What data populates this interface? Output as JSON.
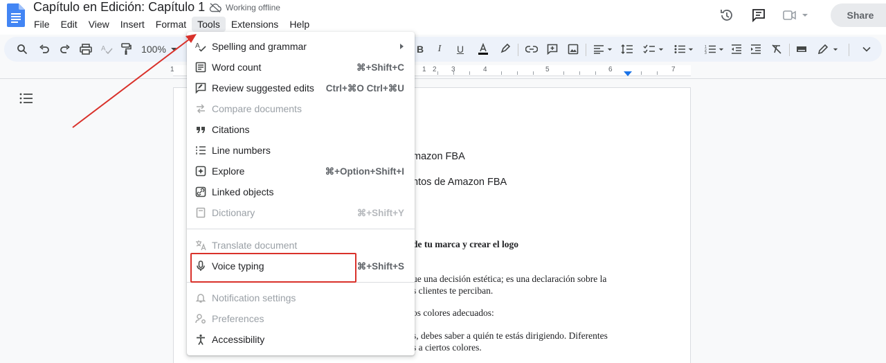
{
  "header": {
    "title": "Capítulo en Edición: Capítulo 1",
    "offline_status": "Working offline",
    "share_label": "Share"
  },
  "menubar": {
    "items": [
      "File",
      "Edit",
      "View",
      "Insert",
      "Format",
      "Tools",
      "Extensions",
      "Help"
    ],
    "active": "Tools"
  },
  "toolbar": {
    "zoom": "100%"
  },
  "ruler": {
    "labels": [
      "1",
      "1",
      "2",
      "3",
      "4",
      "5",
      "6",
      "7"
    ]
  },
  "document": {
    "lines": [
      "mazon FBA",
      "ntos de Amazon FBA",
      "de tu marca y crear el logo",
      "ue una decisión estética; es una declaración sobre la",
      "s clientes te perciban.",
      "os colores adecuados:",
      "s, debes saber a quién te estás dirigiendo. Diferentes",
      "s a ciertos colores."
    ]
  },
  "tools_menu": {
    "items": [
      {
        "label": "Spelling and grammar",
        "shortcut": "",
        "submenu": true,
        "disabled": false,
        "icon": "spellcheck-icon"
      },
      {
        "label": "Word count",
        "shortcut": "⌘+Shift+C",
        "disabled": false,
        "icon": "word-count-icon"
      },
      {
        "label": "Review suggested edits",
        "shortcut": "Ctrl+⌘O Ctrl+⌘U",
        "disabled": false,
        "icon": "review-edits-icon"
      },
      {
        "label": "Compare documents",
        "shortcut": "",
        "disabled": true,
        "icon": "compare-icon"
      },
      {
        "label": "Citations",
        "shortcut": "",
        "disabled": false,
        "icon": "quote-icon"
      },
      {
        "label": "Line numbers",
        "shortcut": "",
        "disabled": false,
        "icon": "line-numbers-icon"
      },
      {
        "label": "Explore",
        "shortcut": "⌘+Option+Shift+I",
        "disabled": false,
        "icon": "explore-icon"
      },
      {
        "label": "Linked objects",
        "shortcut": "",
        "disabled": false,
        "icon": "linked-objects-icon"
      },
      {
        "label": "Dictionary",
        "shortcut": "⌘+Shift+Y",
        "disabled": true,
        "icon": "dictionary-icon"
      },
      {
        "label": "Translate document",
        "shortcut": "",
        "disabled": true,
        "icon": "translate-icon"
      },
      {
        "label": "Voice typing",
        "shortcut": "⌘+Shift+S",
        "disabled": false,
        "icon": "microphone-icon"
      },
      {
        "label": "Notification settings",
        "shortcut": "",
        "disabled": true,
        "icon": "bell-icon"
      },
      {
        "label": "Preferences",
        "shortcut": "",
        "disabled": true,
        "icon": "preferences-icon"
      },
      {
        "label": "Accessibility",
        "shortcut": "",
        "disabled": false,
        "icon": "accessibility-icon"
      }
    ]
  },
  "annotations": {
    "highlight_color": "#d9312a",
    "highlighted_item": "Voice typing"
  }
}
